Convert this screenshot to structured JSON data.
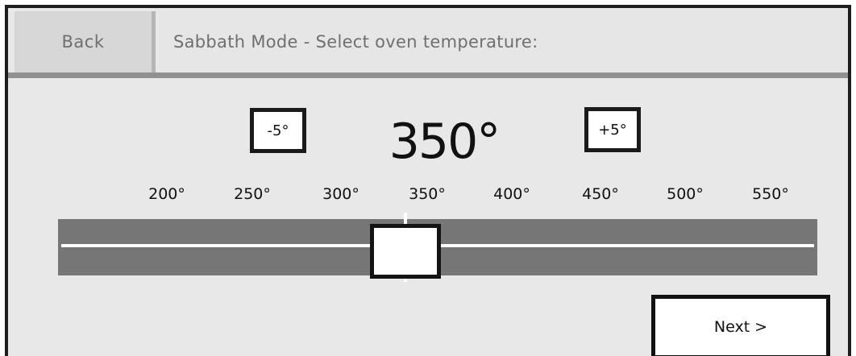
{
  "header": {
    "back_label": "Back",
    "title": "Sabbath Mode - Select oven temperature:"
  },
  "controls": {
    "minus_label": "-5°",
    "plus_label": "+5°",
    "temperature": "350°"
  },
  "slider": {
    "ticks": [
      "200°",
      "250°",
      "300°",
      "350°",
      "400°",
      "450°",
      "500°",
      "550°"
    ],
    "selected": "350°",
    "min": 200,
    "max": 550,
    "value": 350
  },
  "footer": {
    "next_label": "Next >"
  },
  "colors": {
    "background": "#e8e8e8",
    "track": "#767676",
    "border": "#1e1e1e",
    "header_text": "#6f6f6f"
  }
}
